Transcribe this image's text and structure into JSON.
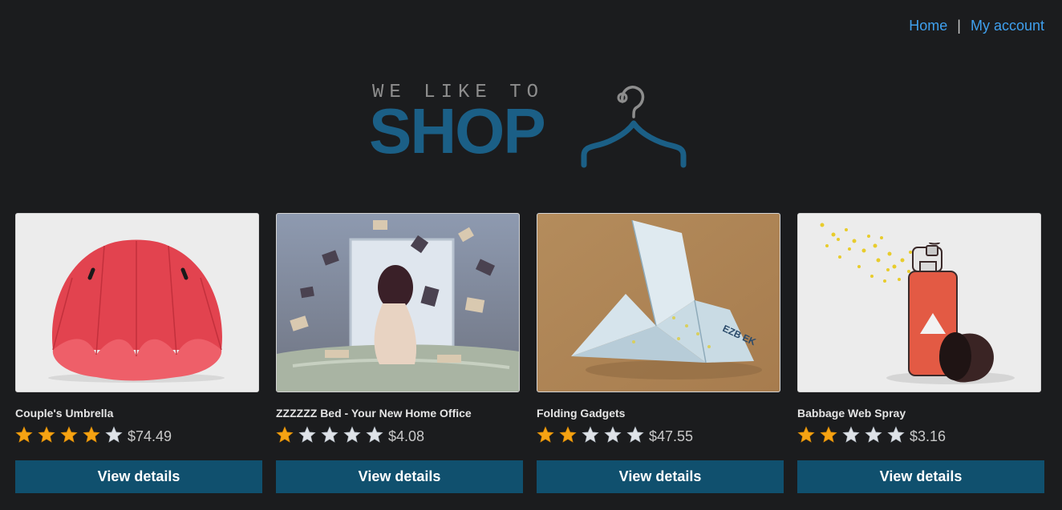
{
  "nav": {
    "home_label": "Home",
    "separator": "|",
    "account_label": "My account"
  },
  "logo": {
    "tagline": "WE LIKE TO",
    "word": "SHOP",
    "icon": "hanger-icon"
  },
  "products": [
    {
      "title": "Couple's Umbrella",
      "rating": 4,
      "max_rating": 5,
      "price": "$74.49",
      "button": "View details",
      "image": "red-umbrella"
    },
    {
      "title": "ZZZZZZ Bed - Your New Home Office",
      "rating": 1,
      "max_rating": 5,
      "price": "$4.08",
      "button": "View details",
      "image": "woman-bed-flying-books"
    },
    {
      "title": "Folding Gadgets",
      "rating": 2,
      "max_rating": 5,
      "price": "$47.55",
      "button": "View details",
      "image": "origami-banknote-bird"
    },
    {
      "title": "Babbage Web Spray",
      "rating": 2,
      "max_rating": 5,
      "price": "$3.16",
      "button": "View details",
      "image": "spray-can"
    }
  ],
  "colors": {
    "background": "#1b1c1e",
    "link": "#3fa0ee",
    "brand": "#1b5f86",
    "button": "#10506e",
    "star_filled": "#f6a313",
    "star_empty": "#dfe3e8"
  }
}
